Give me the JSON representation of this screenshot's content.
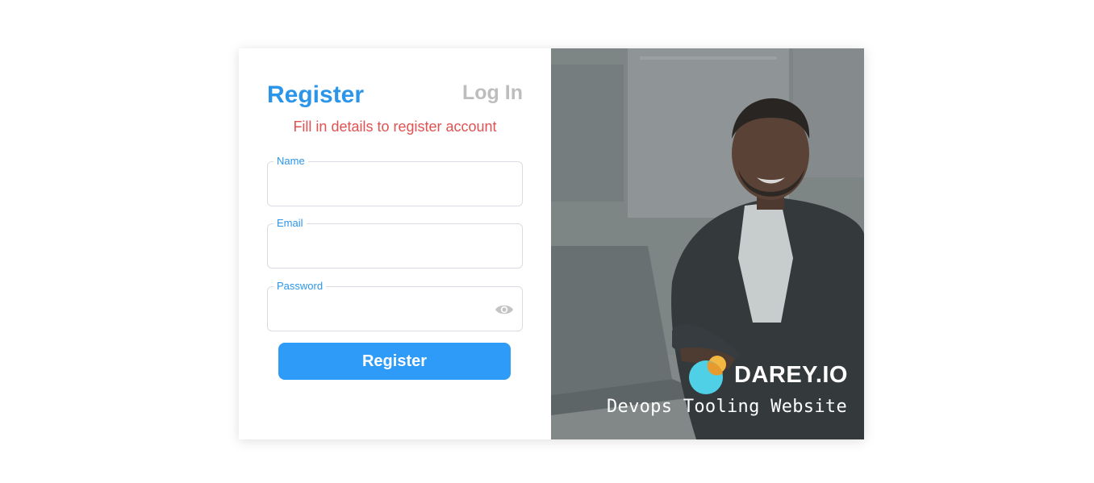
{
  "tabs": {
    "register": "Register",
    "login": "Log In"
  },
  "subtitle": "Fill in details to register account",
  "fields": {
    "name": {
      "label": "Name",
      "value": ""
    },
    "email": {
      "label": "Email",
      "value": ""
    },
    "password": {
      "label": "Password",
      "value": ""
    }
  },
  "submit_label": "Register",
  "brand": {
    "name": "DAREY.IO",
    "tagline": "Devops Tooling Website"
  },
  "icons": {
    "password_toggle": "eye-icon",
    "brand_logo": "darey-logo-icon"
  },
  "colors": {
    "accent": "#2b95e9",
    "button": "#2d9bf7",
    "subtitle": "#e05252",
    "inactive_tab": "#bdbdbd"
  }
}
